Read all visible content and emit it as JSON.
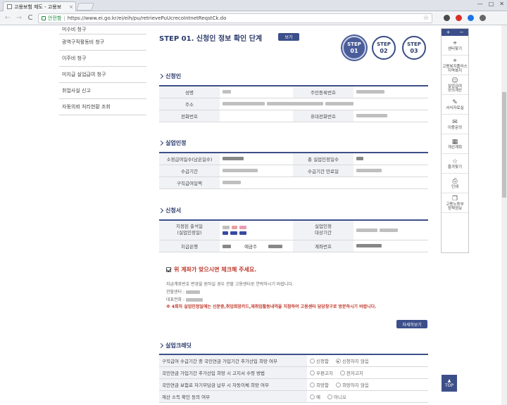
{
  "browser": {
    "tab_title": "고용보험 제도 - 고용보",
    "tab_close": "×",
    "secure_label": "안전함",
    "separator": "|",
    "url": "https://www.ei.go.kr/ei/eih/pu/retrievePuUcrecoIntnetReqstCk.do",
    "back": "←",
    "forward": "→",
    "reload": "C",
    "star": "☆",
    "win_min": "—",
    "win_max": "□",
    "win_close": "✕"
  },
  "leftnav": {
    "items": [
      {
        "label": "미수비 청구"
      },
      {
        "label": "광역구직활동비 청구"
      },
      {
        "label": "이주비 청구"
      },
      {
        "label": "미지급 실업급여 청구"
      },
      {
        "label": "취업사실 신고"
      },
      {
        "label": "자동의뢰 처리현황 조회"
      }
    ]
  },
  "main": {
    "step_title": "STEP 01. 신청인 정보 확인 단계",
    "view_button": "보기",
    "steps": [
      {
        "label": "STEP",
        "num": "01",
        "active": true
      },
      {
        "label": "STEP",
        "num": "02",
        "active": false
      },
      {
        "label": "STEP",
        "num": "03",
        "active": false
      }
    ],
    "applicant": {
      "title": "신청인",
      "name_label": "성명",
      "rrn_label": "주민등록번호",
      "address_label": "주소",
      "phone_label": "전화번호",
      "mobile_label": "휴대전화번호"
    },
    "recognition": {
      "title": "실업인정",
      "benefit_days_label": "소정급여일수(남은일수)",
      "total_days_label": "총 실업인정일수",
      "period_label": "수급기간",
      "period_end_label": "수급기간 만료일",
      "daily_label": "구직급여일액"
    },
    "application": {
      "title": "신청서",
      "attend_date_label": "지정된 출석일\n(실업인정일)",
      "target_period_label": "실업인정\n대상기간",
      "bank_label": "지급은행",
      "holder_label": "예금주",
      "account_label": "계좌번호"
    },
    "confirm_text": "위 계좌가 맞으시면 체크해 주세요.",
    "notice_account_change": "지급계좌번호 변경을 원하실 경우 관할 고용센터로 연락하시기 바랍니다.",
    "notice_center_label": "관할센터 :",
    "notice_phone_label": "대표전화 :",
    "notice_warning": "※ 4회차 실업인정일에는 신분증,취업희망카드,재취업활동내역을 지참하여 고용센터 담당창구로 방문하시기 바랍니다.",
    "detail_button": "자세히보기",
    "credit": {
      "title": "실업크레딧",
      "rows": [
        {
          "question": "구직급여 수급기간 중 국민연금 가입기간 추가산입 희망 여부",
          "options": [
            "신청함",
            "신청하지 않음"
          ],
          "selected": 1
        },
        {
          "question": "국민연금 가입기간 추가산입 희망 시 고지서 수령 방법",
          "options": [
            "우편고지",
            "전자고지"
          ],
          "selected": -1
        },
        {
          "question": "국민연금 보험료 자기부담금 납부 시 자동이체 희망 여부",
          "options": [
            "희망함",
            "희망하지 않음"
          ],
          "selected": -1
        },
        {
          "question": "재산 소득 확인 동의 여부",
          "options": [
            "예",
            "아니오"
          ],
          "selected": -1
        }
      ]
    }
  },
  "quickmenu": {
    "head_plus": "+",
    "head_minus": "−",
    "items": [
      {
        "icon": "location-icon",
        "glyph": "⌖",
        "label": "센터찾기"
      },
      {
        "icon": "location-icon",
        "glyph": "⌖",
        "label": "고용복지플러스\n지역복지"
      },
      {
        "icon": "person-icon",
        "glyph": "☺",
        "label": "실업급여\n모의계산"
      },
      {
        "icon": "pencil-icon",
        "glyph": "✎",
        "label": "서식자료실"
      },
      {
        "icon": "chat-icon",
        "glyph": "✉",
        "label": "이용문의"
      },
      {
        "icon": "calendar-icon",
        "glyph": "▦",
        "label": "개선계획"
      },
      {
        "icon": "star-icon",
        "glyph": "☆",
        "label": "즐겨찾기"
      },
      {
        "icon": "print-icon",
        "glyph": "⎙",
        "label": "인쇄"
      },
      {
        "icon": "copy-icon",
        "glyph": "❐",
        "label": "고용노동부\n정책정보"
      }
    ],
    "top_label": "TOP",
    "top_arrow": "▲"
  },
  "colors": {
    "accent": "#3d4f8a",
    "warning": "#c0392b",
    "secure": "#1a8a3a"
  }
}
